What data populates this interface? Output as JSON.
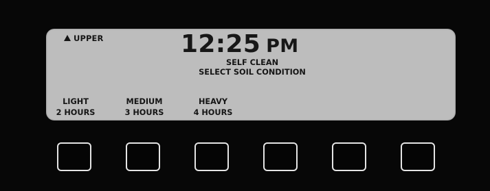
{
  "display": {
    "oven_indicator": "UPPER",
    "oven_indicator_icon": "triangle-up-icon",
    "time": "12:25",
    "ampm": "PM",
    "mode": "SELF CLEAN",
    "instruction": "SELECT SOIL CONDITION",
    "options": [
      {
        "line1": "LIGHT",
        "line2": "2 HOURS"
      },
      {
        "line1": "MEDIUM",
        "line2": "3 HOURS"
      },
      {
        "line1": "HEAVY",
        "line2": "4 HOURS"
      }
    ]
  },
  "colors": {
    "panel": "#070707",
    "display": "#bdbdbd",
    "display_text": "#151515",
    "key_border": "#e5e5e5"
  }
}
